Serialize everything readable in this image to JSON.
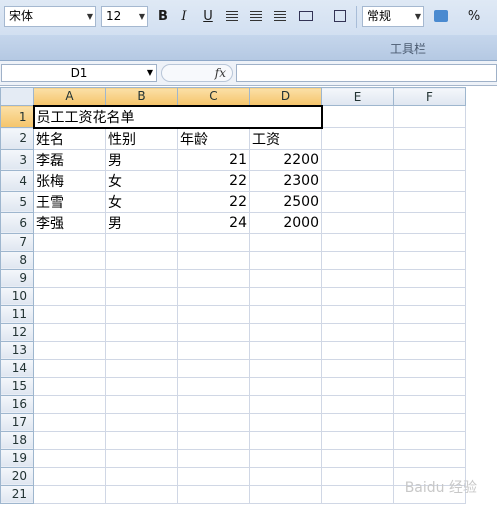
{
  "toolbar": {
    "font_name": "宋体",
    "font_size": "12",
    "bold_label": "B",
    "italic_label": "I",
    "underline_label": "U",
    "number_format": "常规",
    "percent_label": "%",
    "group_label": "工具栏"
  },
  "formula_bar": {
    "name_box": "D1",
    "fx_label": "fx",
    "value": ""
  },
  "columns": [
    "A",
    "B",
    "C",
    "D",
    "E",
    "F"
  ],
  "rows": [
    {
      "n": "1",
      "cells": [
        "员工工资花名单",
        "",
        "",
        "",
        "",
        ""
      ]
    },
    {
      "n": "2",
      "cells": [
        "姓名",
        "性别",
        "年龄",
        "工资",
        "",
        ""
      ]
    },
    {
      "n": "3",
      "cells": [
        "李磊",
        "男",
        "21",
        "2200",
        "",
        ""
      ]
    },
    {
      "n": "4",
      "cells": [
        "张梅",
        "女",
        "22",
        "2300",
        "",
        ""
      ]
    },
    {
      "n": "5",
      "cells": [
        "王雪",
        "女",
        "22",
        "2500",
        "",
        ""
      ]
    },
    {
      "n": "6",
      "cells": [
        "李强",
        "男",
        "24",
        "2000",
        "",
        ""
      ]
    },
    {
      "n": "7",
      "cells": [
        "",
        "",
        "",
        "",
        "",
        ""
      ]
    },
    {
      "n": "8",
      "cells": [
        "",
        "",
        "",
        "",
        "",
        ""
      ]
    },
    {
      "n": "9",
      "cells": [
        "",
        "",
        "",
        "",
        "",
        ""
      ]
    },
    {
      "n": "10",
      "cells": [
        "",
        "",
        "",
        "",
        "",
        ""
      ]
    },
    {
      "n": "11",
      "cells": [
        "",
        "",
        "",
        "",
        "",
        ""
      ]
    },
    {
      "n": "12",
      "cells": [
        "",
        "",
        "",
        "",
        "",
        ""
      ]
    },
    {
      "n": "13",
      "cells": [
        "",
        "",
        "",
        "",
        "",
        ""
      ]
    },
    {
      "n": "14",
      "cells": [
        "",
        "",
        "",
        "",
        "",
        ""
      ]
    },
    {
      "n": "15",
      "cells": [
        "",
        "",
        "",
        "",
        "",
        ""
      ]
    },
    {
      "n": "16",
      "cells": [
        "",
        "",
        "",
        "",
        "",
        ""
      ]
    },
    {
      "n": "17",
      "cells": [
        "",
        "",
        "",
        "",
        "",
        ""
      ]
    },
    {
      "n": "18",
      "cells": [
        "",
        "",
        "",
        "",
        "",
        ""
      ]
    },
    {
      "n": "19",
      "cells": [
        "",
        "",
        "",
        "",
        "",
        ""
      ]
    },
    {
      "n": "20",
      "cells": [
        "",
        "",
        "",
        "",
        "",
        ""
      ]
    },
    {
      "n": "21",
      "cells": [
        "",
        "",
        "",
        "",
        "",
        ""
      ]
    }
  ],
  "selected_columns": [
    "A",
    "B",
    "C",
    "D"
  ],
  "watermark": "Baidu 经验"
}
